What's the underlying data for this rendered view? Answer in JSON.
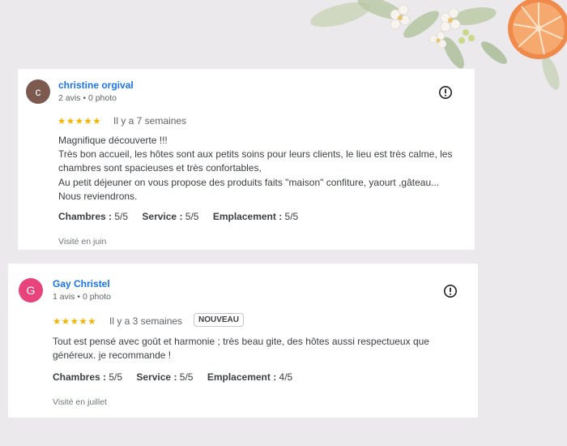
{
  "reviews": [
    {
      "avatar_letter": "c",
      "avatar_color": "#7d5a50",
      "name": "christine orgival",
      "meta": "2 avis • 0 photo",
      "stars": "★★★★★",
      "rating": 5,
      "when": "Il y a 7 semaines",
      "lines": [
        "Magnifique découverte !!!",
        "Très bon accueil, les hôtes sont aux petits soins pour leurs clients, le lieu est très calme, les",
        "chambres sont spacieuses et très confortables,",
        "Au petit déjeuner on vous propose des produits faits \"maison\" confiture, yaourt ,gâteau...",
        "Nous reviendrons."
      ],
      "ratings": [
        {
          "label": "Chambres :",
          "value": "5/5"
        },
        {
          "label": "Service :",
          "value": "5/5"
        },
        {
          "label": "Emplacement :",
          "value": "5/5"
        }
      ],
      "visited": "Visité en juin"
    },
    {
      "avatar_letter": "G",
      "avatar_color": "#e8437a",
      "name": "Gay Christel",
      "meta": "1 avis • 0 photo",
      "stars": "★★★★★",
      "rating": 5,
      "when": "Il y a 3 semaines",
      "badge": "NOUVEAU",
      "lines": [
        "Tout est pensé avec goût et harmonie ; très beau gite, des hôtes aussi respectueux que",
        "généreux. je recommande !"
      ],
      "ratings": [
        {
          "label": "Chambres :",
          "value": "5/5"
        },
        {
          "label": "Service :",
          "value": "5/5"
        },
        {
          "label": "Emplacement :",
          "value": "4/5"
        }
      ],
      "visited": "Visité en juillet"
    }
  ],
  "colors": {
    "name_link": "#1a73e8",
    "star": "#f5b400",
    "background": "#ece9ec"
  }
}
